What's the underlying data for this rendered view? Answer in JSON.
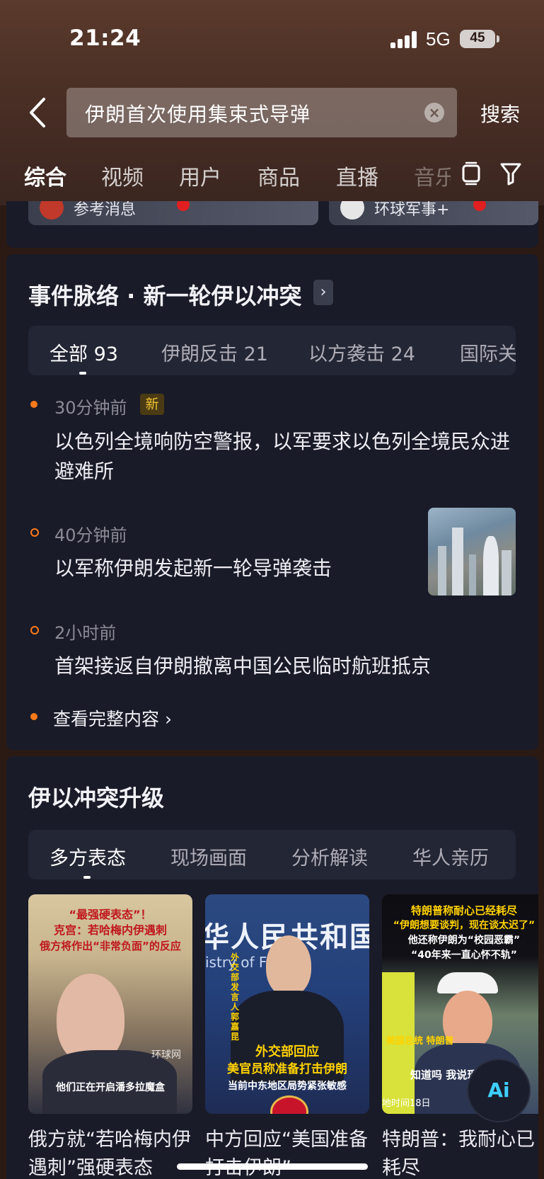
{
  "status_bar": {
    "time": "21:24",
    "network": "5G",
    "battery": "45"
  },
  "search": {
    "query": "伊朗首次使用集束式导弹",
    "button": "搜索"
  },
  "tabs": [
    "综合",
    "视频",
    "用户",
    "商品",
    "直播",
    "音乐"
  ],
  "top_cards": [
    {
      "name": "参考消息"
    },
    {
      "name": "环球军事+"
    }
  ],
  "event_section": {
    "title": "事件脉络 · 新一轮伊以冲突",
    "filters": [
      "全部 93",
      "伊朗反击 21",
      "以方袭击 24",
      "国际关"
    ],
    "items": [
      {
        "time": "30分钟前",
        "badge": "新",
        "text": "以色列全境响防空警报，以军要求以色列全境民众进避难所"
      },
      {
        "time": "40分钟前",
        "text": "以军称伊朗发起新一轮导弹袭击"
      },
      {
        "time": "2小时前",
        "text": "首架接返自伊朗撤离中国公民临时航班抵京"
      }
    ],
    "more": "查看完整内容"
  },
  "conflict_section": {
    "title": "伊以冲突升级",
    "filters": [
      "多方表态",
      "现场画面",
      "分析解读",
      "华人亲历"
    ],
    "videos": [
      {
        "cap1": "“最强硬表态”！",
        "cap2": "克宫：若哈梅内伊遇刺",
        "cap3": "俄方将作出“非常负面”的反应",
        "sub": "他们正在开启潘多拉魔盒",
        "watermark": "环球网",
        "title": "俄方就“若哈梅内伊遇刺”强硬表态"
      },
      {
        "bg_text": "华人民共和国",
        "bg_text_en": "istry of Foreign",
        "side": "外交部发言人 郭嘉昆",
        "cap1": "外交部回应",
        "cap2": "美官员称准备打击伊朗",
        "cap3": "当前中东地区局势紧张敏感",
        "title": "中方回应“美国准备打击伊朗”"
      },
      {
        "cap1": "特朗普称耐心已经耗尽",
        "cap2": "“伊朗想要谈判，现在谈太迟了”",
        "cap3": "他还称伊朗为“校园恶霸”",
        "cap4": "“40年来一直心怀不轨”",
        "label": "美国总统 特朗普",
        "sub": "知道吗 我说现",
        "footer": "地时间18日",
        "title": "特朗普：我耐心已耗尽"
      }
    ]
  },
  "ai_button": "Ai"
}
